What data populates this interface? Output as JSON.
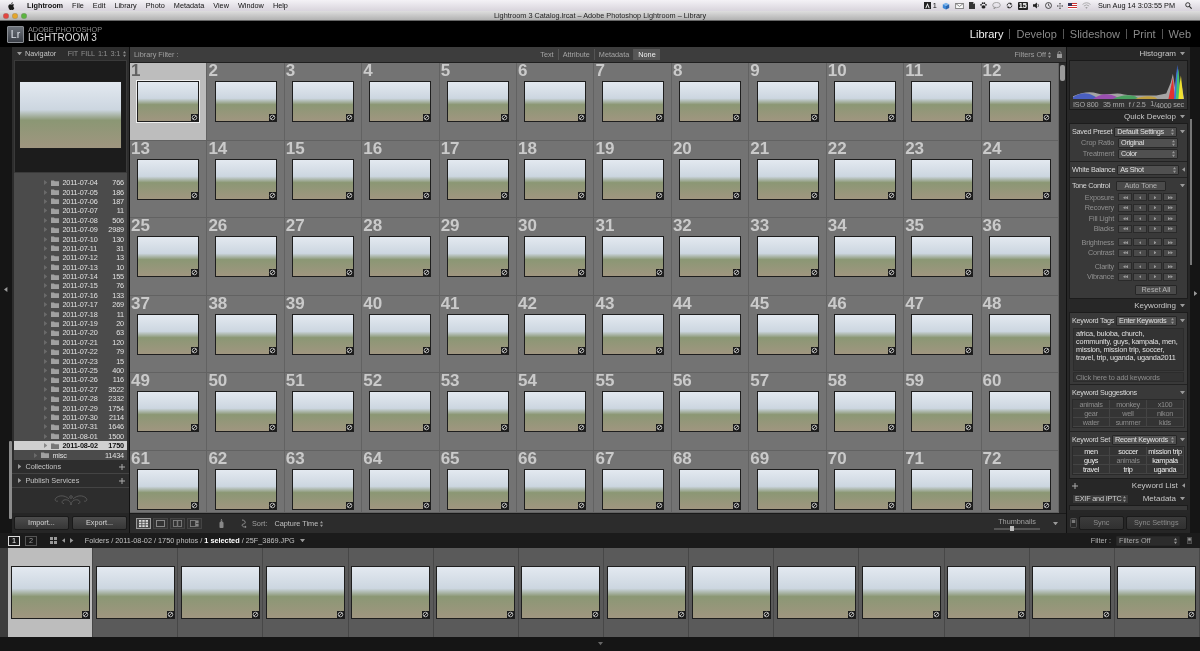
{
  "menu_bar": {
    "app": "Lightroom",
    "menus": [
      "File",
      "Edit",
      "Library",
      "Photo",
      "Metadata",
      "View",
      "Window",
      "Help"
    ],
    "badge_count": "1",
    "calendar_day": "15",
    "clock": "Sun Aug 14 3:03:55 PM"
  },
  "window": {
    "title": "Lightroom 3 Catalog.lrcat – Adobe Photoshop Lightroom – Library"
  },
  "identity_plate": {
    "logo": "Lr",
    "brand": "ADOBE PHOTOSHOP",
    "product": "LIGHTROOM 3"
  },
  "modules": [
    {
      "label": "Library",
      "selected": true
    },
    {
      "label": "Develop",
      "selected": false
    },
    {
      "label": "Slideshow",
      "selected": false
    },
    {
      "label": "Print",
      "selected": false
    },
    {
      "label": "Web",
      "selected": false
    }
  ],
  "left_panel": {
    "navigator": {
      "title": "Navigator",
      "expanded": true,
      "zoom_options": [
        "FIT",
        "FILL",
        "1:1",
        "3:1"
      ]
    },
    "folders": [
      {
        "children": [
          {
            "name": "2011-07-04",
            "count": "766",
            "selected": false
          },
          {
            "name": "2011-07-05",
            "count": "186",
            "selected": false
          },
          {
            "name": "2011-07-06",
            "count": "187",
            "selected": false
          },
          {
            "name": "2011-07-07",
            "count": "11",
            "selected": false
          },
          {
            "name": "2011-07-08",
            "count": "506",
            "selected": false
          },
          {
            "name": "2011-07-09",
            "count": "2989",
            "selected": false
          },
          {
            "name": "2011-07-10",
            "count": "130",
            "selected": false
          },
          {
            "name": "2011-07-11",
            "count": "31",
            "selected": false
          },
          {
            "name": "2011-07-12",
            "count": "13",
            "selected": false
          },
          {
            "name": "2011-07-13",
            "count": "10",
            "selected": false
          },
          {
            "name": "2011-07-14",
            "count": "155",
            "selected": false
          },
          {
            "name": "2011-07-15",
            "count": "76",
            "selected": false
          },
          {
            "name": "2011-07-16",
            "count": "133",
            "selected": false
          },
          {
            "name": "2011-07-17",
            "count": "269",
            "selected": false
          },
          {
            "name": "2011-07-18",
            "count": "11",
            "selected": false
          },
          {
            "name": "2011-07-19",
            "count": "20",
            "selected": false
          },
          {
            "name": "2011-07-20",
            "count": "63",
            "selected": false
          },
          {
            "name": "2011-07-21",
            "count": "120",
            "selected": false
          },
          {
            "name": "2011-07-22",
            "count": "79",
            "selected": false
          },
          {
            "name": "2011-07-23",
            "count": "15",
            "selected": false
          },
          {
            "name": "2011-07-25",
            "count": "400",
            "selected": false
          },
          {
            "name": "2011-07-26",
            "count": "116",
            "selected": false
          },
          {
            "name": "2011-07-27",
            "count": "3522",
            "selected": false
          },
          {
            "name": "2011-07-28",
            "count": "2332",
            "selected": false
          },
          {
            "name": "2011-07-29",
            "count": "1754",
            "selected": false
          },
          {
            "name": "2011-07-30",
            "count": "2114",
            "selected": false
          },
          {
            "name": "2011-07-31",
            "count": "1646",
            "selected": false
          },
          {
            "name": "2011-08-01",
            "count": "1500",
            "selected": false
          },
          {
            "name": "2011-08-02",
            "count": "1750",
            "selected": true
          }
        ]
      },
      {
        "name": "misc",
        "count": "11434",
        "selected": false
      }
    ],
    "sections": [
      {
        "title": "Collections",
        "expanded": false
      },
      {
        "title": "Publish Services",
        "expanded": false
      }
    ],
    "buttons": [
      "Import...",
      "Export..."
    ]
  },
  "library_filter": {
    "label": "Library Filter :",
    "tabs": [
      {
        "label": "Text",
        "selected": false
      },
      {
        "label": "Attribute",
        "selected": false
      },
      {
        "label": "Metadata",
        "selected": false
      },
      {
        "label": "None",
        "selected": true
      }
    ],
    "preset": "Filters Off"
  },
  "grid": {
    "cells": [
      {
        "index": "1",
        "selected": true
      },
      {
        "index": "2",
        "selected": false
      },
      {
        "index": "3",
        "selected": false
      },
      {
        "index": "4",
        "selected": false
      },
      {
        "index": "5",
        "selected": false
      },
      {
        "index": "6",
        "selected": false
      },
      {
        "index": "7",
        "selected": false
      },
      {
        "index": "8",
        "selected": false
      },
      {
        "index": "9",
        "selected": false
      },
      {
        "index": "10",
        "selected": false
      },
      {
        "index": "11",
        "selected": false
      },
      {
        "index": "12",
        "selected": false
      },
      {
        "index": "13",
        "selected": false
      },
      {
        "index": "14",
        "selected": false
      },
      {
        "index": "15",
        "selected": false
      },
      {
        "index": "16",
        "selected": false
      },
      {
        "index": "17",
        "selected": false
      },
      {
        "index": "18",
        "selected": false
      },
      {
        "index": "19",
        "selected": false
      },
      {
        "index": "20",
        "selected": false
      },
      {
        "index": "21",
        "selected": false
      },
      {
        "index": "22",
        "selected": false
      },
      {
        "index": "23",
        "selected": false
      },
      {
        "index": "24",
        "selected": false
      },
      {
        "index": "25",
        "selected": false
      },
      {
        "index": "26",
        "selected": false
      },
      {
        "index": "27",
        "selected": false
      },
      {
        "index": "28",
        "selected": false
      },
      {
        "index": "29",
        "selected": false
      },
      {
        "index": "30",
        "selected": false
      },
      {
        "index": "31",
        "selected": false
      },
      {
        "index": "32",
        "selected": false
      },
      {
        "index": "33",
        "selected": false
      },
      {
        "index": "34",
        "selected": false
      },
      {
        "index": "35",
        "selected": false
      },
      {
        "index": "36",
        "selected": false
      },
      {
        "index": "37",
        "selected": false
      },
      {
        "index": "38",
        "selected": false
      },
      {
        "index": "39",
        "selected": false
      },
      {
        "index": "40",
        "selected": false
      },
      {
        "index": "41",
        "selected": false
      },
      {
        "index": "42",
        "selected": false
      },
      {
        "index": "43",
        "selected": false
      },
      {
        "index": "44",
        "selected": false
      },
      {
        "index": "45",
        "selected": false
      },
      {
        "index": "46",
        "selected": false
      },
      {
        "index": "47",
        "selected": false
      },
      {
        "index": "48",
        "selected": false
      },
      {
        "index": "49",
        "selected": false
      },
      {
        "index": "50",
        "selected": false
      },
      {
        "index": "51",
        "selected": false
      },
      {
        "index": "52",
        "selected": false
      },
      {
        "index": "53",
        "selected": false
      },
      {
        "index": "54",
        "selected": false
      },
      {
        "index": "55",
        "selected": false
      },
      {
        "index": "56",
        "selected": false
      },
      {
        "index": "57",
        "selected": false
      },
      {
        "index": "58",
        "selected": false
      },
      {
        "index": "59",
        "selected": false
      },
      {
        "index": "60",
        "selected": false
      },
      {
        "index": "61",
        "selected": false
      },
      {
        "index": "62",
        "selected": false
      },
      {
        "index": "63",
        "selected": false
      },
      {
        "index": "64",
        "selected": false
      },
      {
        "index": "65",
        "selected": false
      },
      {
        "index": "66",
        "selected": false
      },
      {
        "index": "67",
        "selected": false
      },
      {
        "index": "68",
        "selected": false
      },
      {
        "index": "69",
        "selected": false
      },
      {
        "index": "70",
        "selected": false
      },
      {
        "index": "71",
        "selected": false
      },
      {
        "index": "72",
        "selected": false
      }
    ]
  },
  "toolbar": {
    "view_modes": [
      {
        "kind": "grid",
        "selected": true
      },
      {
        "kind": "loupe",
        "selected": false
      },
      {
        "kind": "compare",
        "selected": false
      },
      {
        "kind": "survey",
        "selected": false
      }
    ],
    "sort_label": "Sort:",
    "sort_value": "Capture Time",
    "thumbnails_label": "Thumbnails",
    "thumbnail_size": {
      "level": 0.4
    }
  },
  "right_panel": {
    "histogram": {
      "title": "Histogram",
      "expanded": true,
      "info": [
        "ISO 800",
        "35 mm",
        "f / 2.5",
        "$^{1}$/$_{4000}$ sec"
      ]
    },
    "quick_develop": {
      "title": "Quick Develop",
      "expanded": true,
      "saved_preset": {
        "label": "Saved Preset",
        "value": "Default Settings",
        "expanded": true
      },
      "crop_ratio": {
        "label": "Crop Ratio",
        "value": "Original"
      },
      "treatment": {
        "label": "Treatment",
        "value": "Color"
      },
      "white_balance": {
        "label": "White Balance",
        "value": "As Shot",
        "expanded": false
      },
      "tone_control": {
        "label": "Tone Control",
        "button": "Auto Tone",
        "expanded": true
      },
      "adjustment_groups": [
        [
          "Exposure",
          "Recovery",
          "Fill Light",
          "Blacks"
        ],
        [
          "Brightness",
          "Contrast"
        ],
        [
          "Clarity",
          "Vibrance"
        ]
      ],
      "reset_button": "Reset All"
    },
    "keywording": {
      "title": "Keywording",
      "expanded": true,
      "tags": {
        "label": "Keyword Tags",
        "value": "Enter Keywords",
        "expanded": true,
        "text": "africa, buloba, church, community, guys, kampala, men, mission, mission trip, soccer, travel, trip, uganda, uganda2011",
        "placeholder": "Click here to add keywords"
      },
      "suggestions": {
        "label": "Keyword Suggestions",
        "expanded": true,
        "keywords": [
          {
            "label": "animals",
            "applied": false
          },
          {
            "label": "monkey",
            "applied": false
          },
          {
            "label": "x100",
            "applied": false
          },
          {
            "label": "gear",
            "applied": false
          },
          {
            "label": "well",
            "applied": false
          },
          {
            "label": "nikon",
            "applied": false
          },
          {
            "label": "water",
            "applied": false
          },
          {
            "label": "summer",
            "applied": false
          },
          {
            "label": "kids",
            "applied": false
          }
        ]
      },
      "keyword_set": {
        "label": "Keyword Set",
        "value": "Recent Keywords",
        "expanded": true,
        "keywords": [
          {
            "label": "men",
            "applied": true
          },
          {
            "label": "soccer",
            "applied": true
          },
          {
            "label": "mission trip",
            "applied": true
          },
          {
            "label": "guys",
            "applied": true
          },
          {
            "label": "animals",
            "applied": false
          },
          {
            "label": "kampala",
            "applied": true
          },
          {
            "label": "travel",
            "applied": true
          },
          {
            "label": "trip",
            "applied": true
          },
          {
            "label": "uganda",
            "applied": true
          }
        ]
      }
    },
    "keyword_list": {
      "title": "Keyword List",
      "expanded": false
    },
    "metadata": {
      "title": "Metadata",
      "preset": "EXIF and IPTC",
      "expanded": true
    },
    "sync_buttons": [
      {
        "label": "Sync",
        "disabled": true
      },
      {
        "label": "Sync Settings",
        "disabled": true
      }
    ]
  },
  "filmstrip_bar": {
    "monitors": [
      {
        "label": "1",
        "selected": true
      },
      {
        "label": "2",
        "selected": false
      }
    ],
    "source_path": "Folders / 2011-08-02 / 1750 photos / **1 selected** / 25F_3869.JPG",
    "filter_label": "Filter :",
    "filter_value": "Filters Off"
  },
  "filmstrip": {
    "cells": [
      {
        "selected": true
      },
      {
        "selected": false
      },
      {
        "selected": false
      },
      {
        "selected": false
      },
      {
        "selected": false
      },
      {
        "selected": false
      },
      {
        "selected": false
      },
      {
        "selected": false
      },
      {
        "selected": false
      },
      {
        "selected": false
      },
      {
        "selected": false
      },
      {
        "selected": false
      },
      {
        "selected": false
      },
      {
        "selected": false
      }
    ]
  }
}
